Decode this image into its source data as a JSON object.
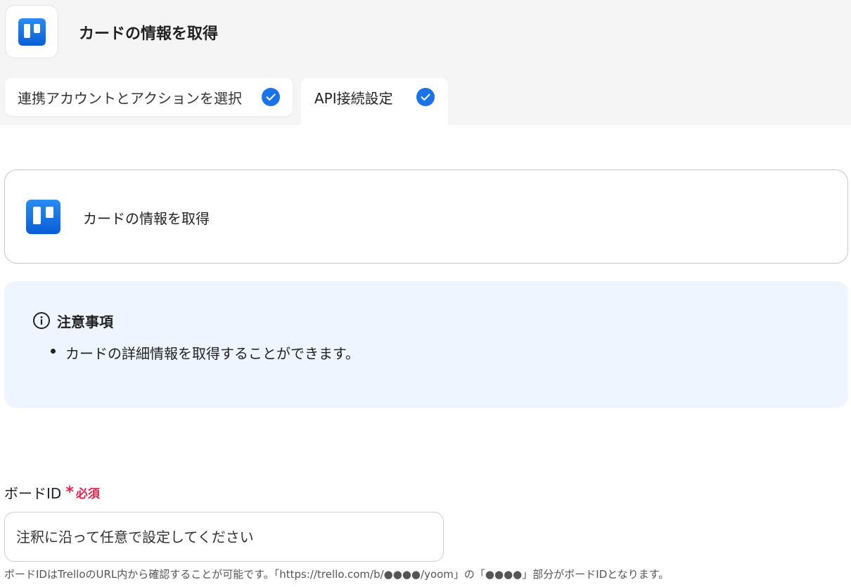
{
  "header": {
    "title": "カードの情報を取得",
    "app_icon": "trello-logo"
  },
  "tabs": [
    {
      "label": "連携アカウントとアクションを選択",
      "completed": true,
      "active": false
    },
    {
      "label": "API接続設定",
      "completed": true,
      "active": true
    }
  ],
  "action_card": {
    "label": "カードの情報を取得",
    "app_icon": "trello-logo"
  },
  "notice": {
    "title": "注意事項",
    "items": [
      "カードの詳細情報を取得することができます。"
    ]
  },
  "field": {
    "label": "ボードID",
    "required_mark": "*",
    "required_text": "必須",
    "placeholder": "注釈に沿って任意で設定してください",
    "value": "",
    "help": "ボードIDはTrelloのURL内から確認することが可能です。「https://trello.com/b/●●●●/yoom」の「●●●●」部分がボードIDとなります。"
  },
  "colors": {
    "accent": "#1a73e8",
    "required": "#e5234d",
    "notice_bg": "#eef5fe",
    "header_bg": "#f5f5f5"
  }
}
